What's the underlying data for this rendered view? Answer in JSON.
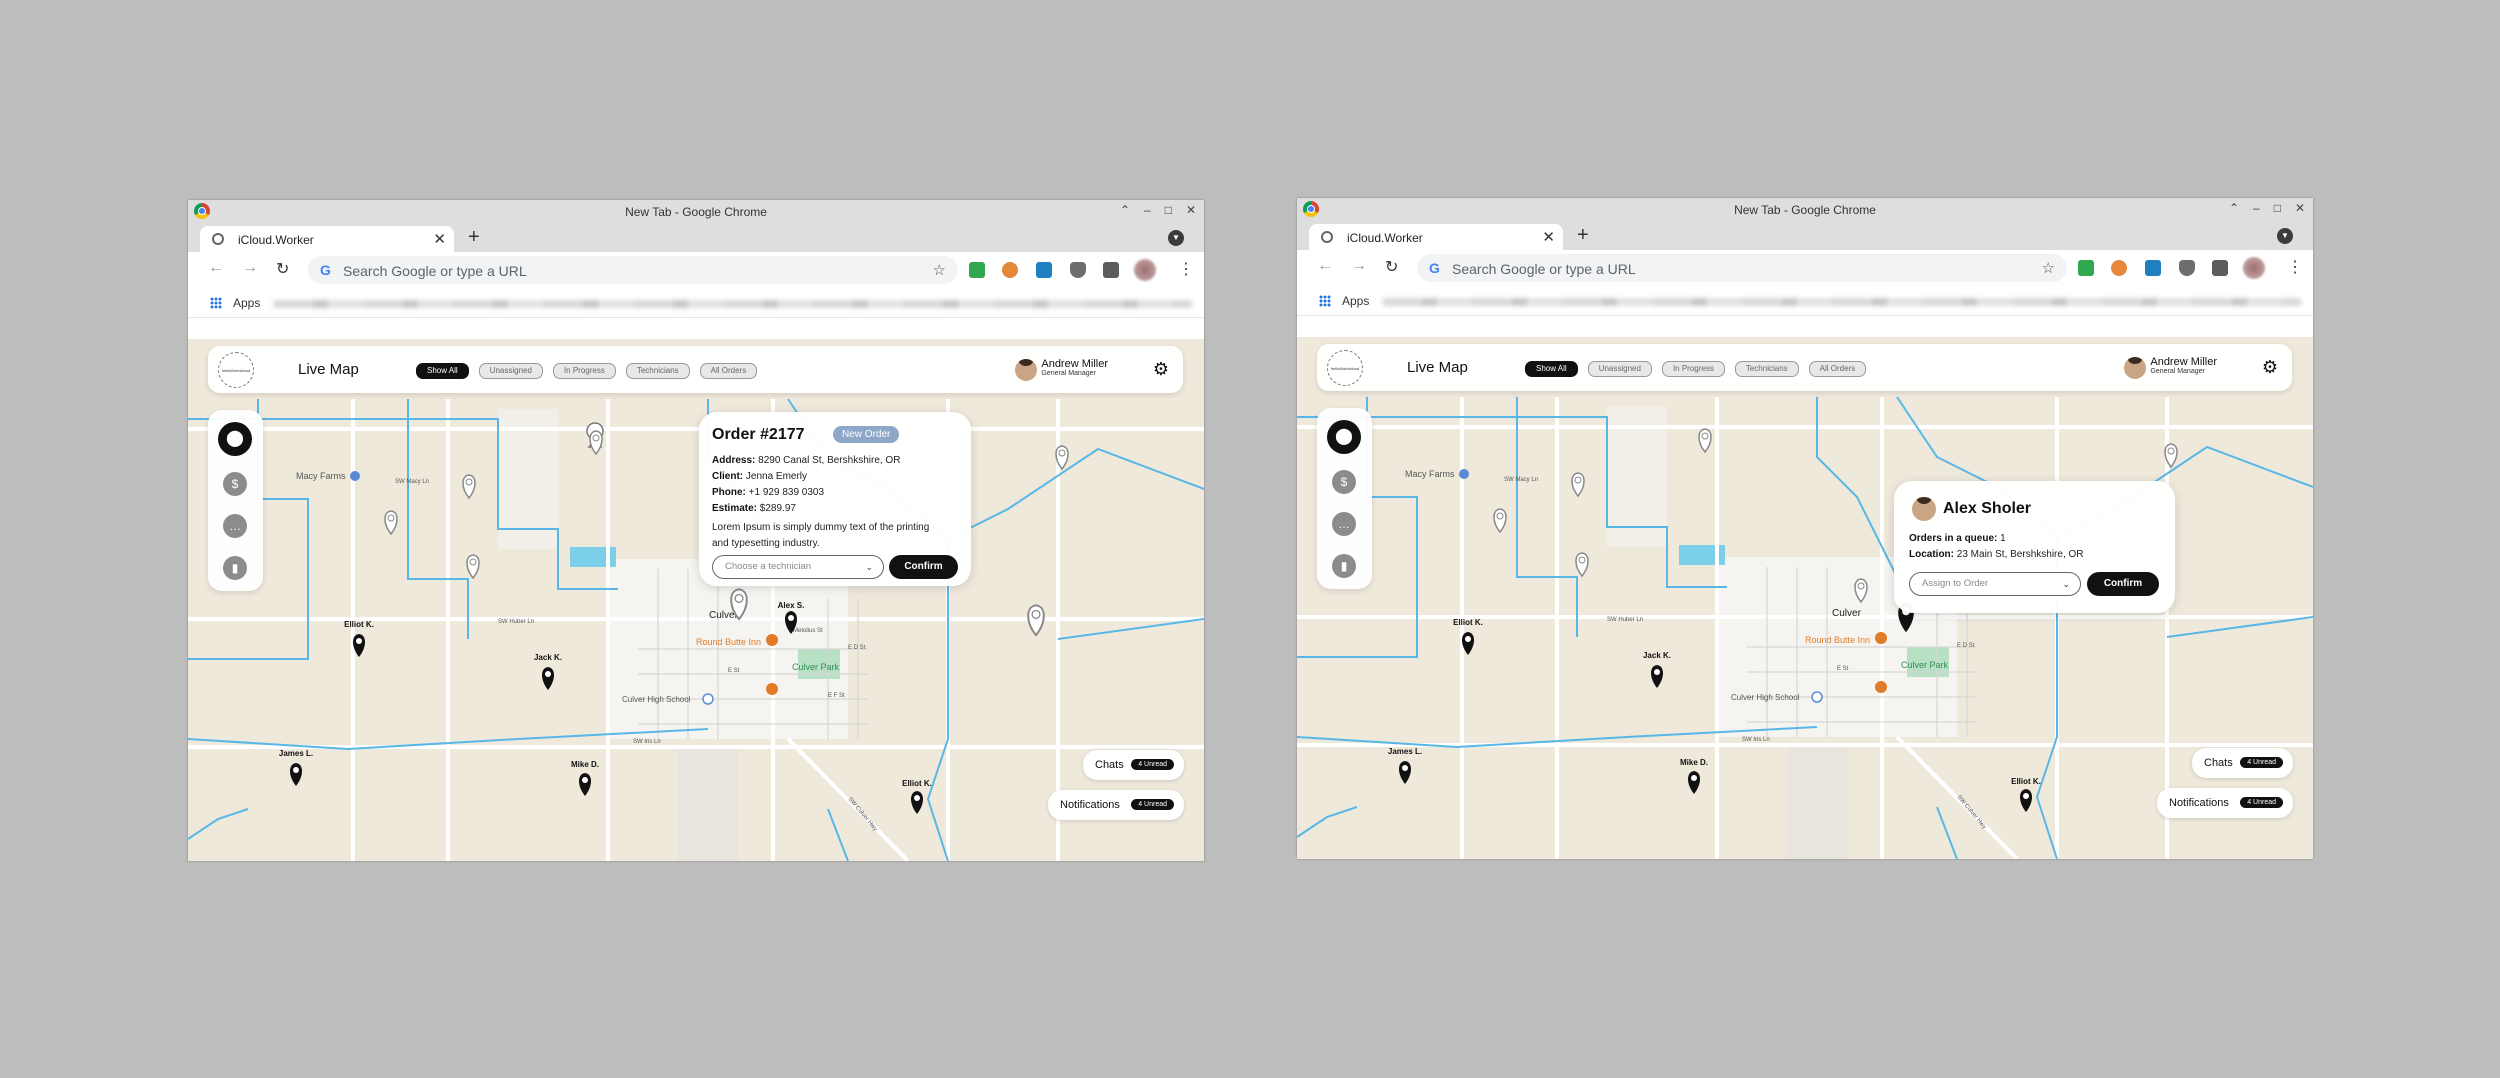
{
  "browser": {
    "window_title": "New Tab - Google Chrome",
    "tab_label": "iCloud.Worker",
    "address_placeholder": "Search Google or type a URL",
    "apps_label": "Apps"
  },
  "app": {
    "logo_text": "helloWorldcloud",
    "title": "Live Map",
    "filters": [
      "Show All",
      "Unassigned",
      "In Progress",
      "Technicians",
      "All Orders"
    ],
    "active_filter": "Show All",
    "user": {
      "name": "Andrew Miller",
      "role": "General Manager"
    },
    "chats": {
      "label": "Chats",
      "badge": "4 Unread"
    },
    "notifications": {
      "label": "Notifications",
      "badge": "4 Unread"
    }
  },
  "map_labels": {
    "macy_farms": "Macy Farms",
    "culver": "Culver",
    "round_butte_inn": "Round Butte Inn",
    "culver_park": "Culver Park",
    "culver_high_school": "Culver High School",
    "sw_macy_ln": "SW Macy Ln",
    "sw_huber_ln": "SW Huber Ln",
    "sw_iris_ln": "SW Iris Ln",
    "e_st": "E St",
    "e_d_st": "E D St",
    "e_f_st": "E F St",
    "metolius_st": "Metolius St",
    "culver_hwy": "SW Culver Hwy"
  },
  "technicians": {
    "elliot_k": "Elliot K.",
    "alex_s": "Alex S.",
    "jack_k": "Jack K.",
    "james_l": "James L.",
    "mike_d": "Mike D."
  },
  "order_popup": {
    "title": "Order #2177",
    "badge": "New Order",
    "address_label": "Address:",
    "address": "8290 Canal St, Bershkshire, OR",
    "client_label": "Client:",
    "client": "Jenna Emerly",
    "phone_label": "Phone:",
    "phone": "+1 929 839 0303",
    "estimate_label": "Estimate:",
    "estimate": "$289.97",
    "description": "Lorem Ipsum is simply dummy text of the printing and typesetting industry.",
    "select_placeholder": "Choose a technician",
    "confirm": "Confirm"
  },
  "tech_popup": {
    "name": "Alex Sholer",
    "queue_label": "Orders in a queue:",
    "queue": "1",
    "location_label": "Location:",
    "location": "23 Main St, Bershkshire, OR",
    "select_placeholder": "Assign to Order",
    "confirm": "Confirm"
  },
  "colors": {
    "map_background": "#efe9dc",
    "water_line": "#58b7e6",
    "road": "#ffffff",
    "park": "#b8e0c4",
    "active_filter": "#111111",
    "new_order_badge": "#8ea6c7",
    "poi_orange": "#e07b28"
  }
}
